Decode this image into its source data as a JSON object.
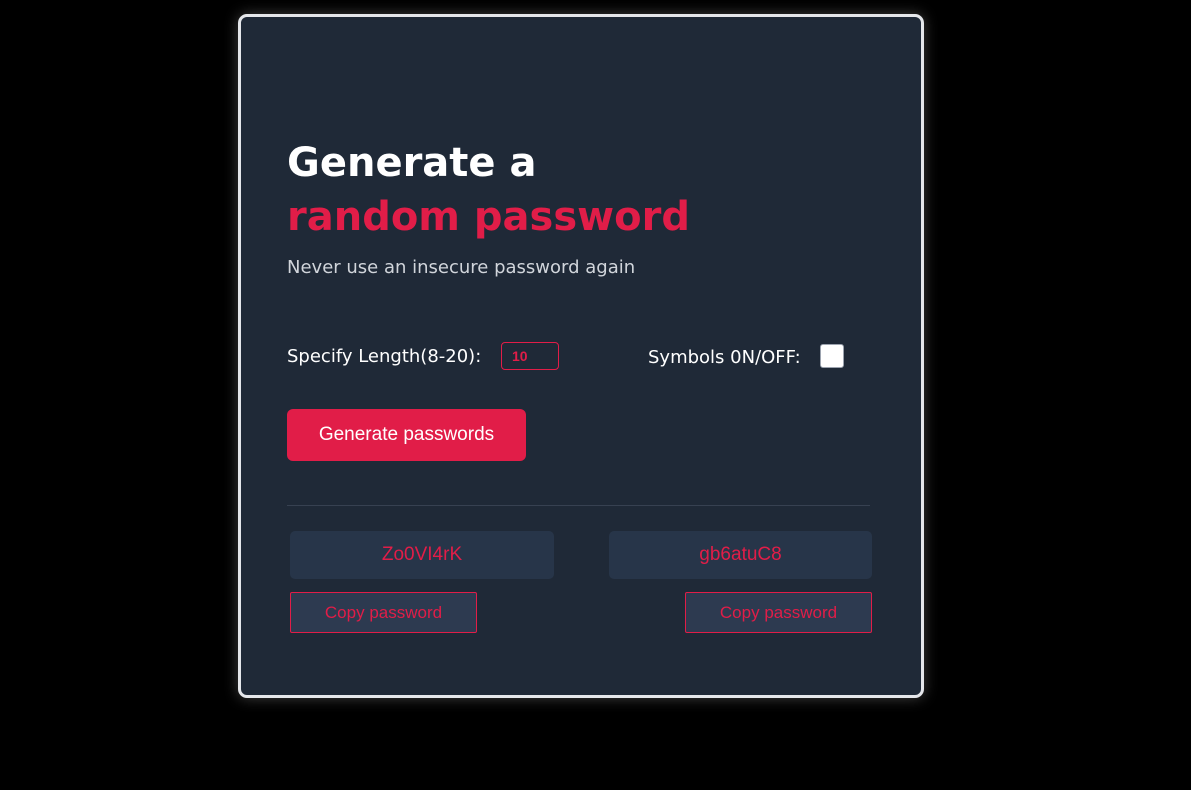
{
  "header": {
    "title_line1": "Generate a",
    "title_line2": "random password",
    "subtitle": "Never use an insecure password again"
  },
  "options": {
    "length_label": "Specify Length(8-20):",
    "length_value": "10",
    "symbols_label": "Symbols 0N/OFF:",
    "symbols_checked": false
  },
  "actions": {
    "generate_label": "Generate passwords"
  },
  "passwords": [
    {
      "value": "Zo0VI4rK",
      "copy_label": "Copy password"
    },
    {
      "value": "gb6atuC8",
      "copy_label": "Copy password"
    }
  ],
  "colors": {
    "background": "#000000",
    "card": "#1f2937",
    "accent": "#e11d48",
    "text": "#ffffff",
    "muted": "#d1d5db"
  }
}
